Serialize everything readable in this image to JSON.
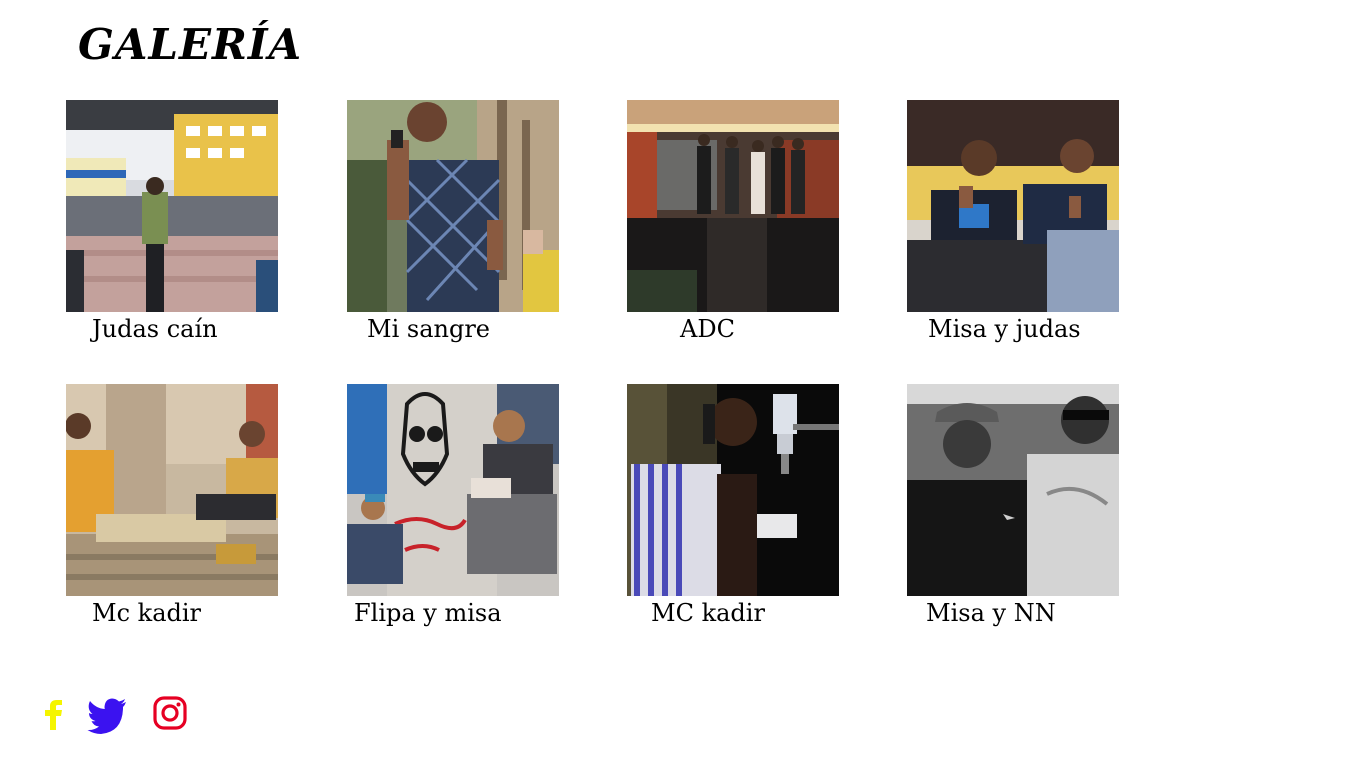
{
  "page": {
    "title": "GALERÍA"
  },
  "gallery": {
    "items": [
      {
        "caption": "Judas caín",
        "photo_alt": "crowd gathered in plaza"
      },
      {
        "caption": "Mi sangre",
        "photo_alt": "rapper with microphone"
      },
      {
        "caption": "ADC",
        "photo_alt": "group on stage in venue"
      },
      {
        "caption": "Misa y judas",
        "photo_alt": "two guys sitting making hand signs"
      },
      {
        "caption": "Mc kadir",
        "photo_alt": "two guys sitting on stairs"
      },
      {
        "caption": "Flipa y misa",
        "photo_alt": "two guys crouching by graffiti wall"
      },
      {
        "caption": "MC kadir",
        "photo_alt": "rapper recording in studio"
      },
      {
        "caption": "Misa y NN",
        "photo_alt": "black and white photo of two guys"
      }
    ]
  },
  "social": {
    "icons": [
      "facebook-icon",
      "twitter-icon",
      "instagram-icon"
    ],
    "colors": {
      "facebook": "#f5f500",
      "twitter": "#3b12f0",
      "instagram": "#e60023"
    }
  }
}
